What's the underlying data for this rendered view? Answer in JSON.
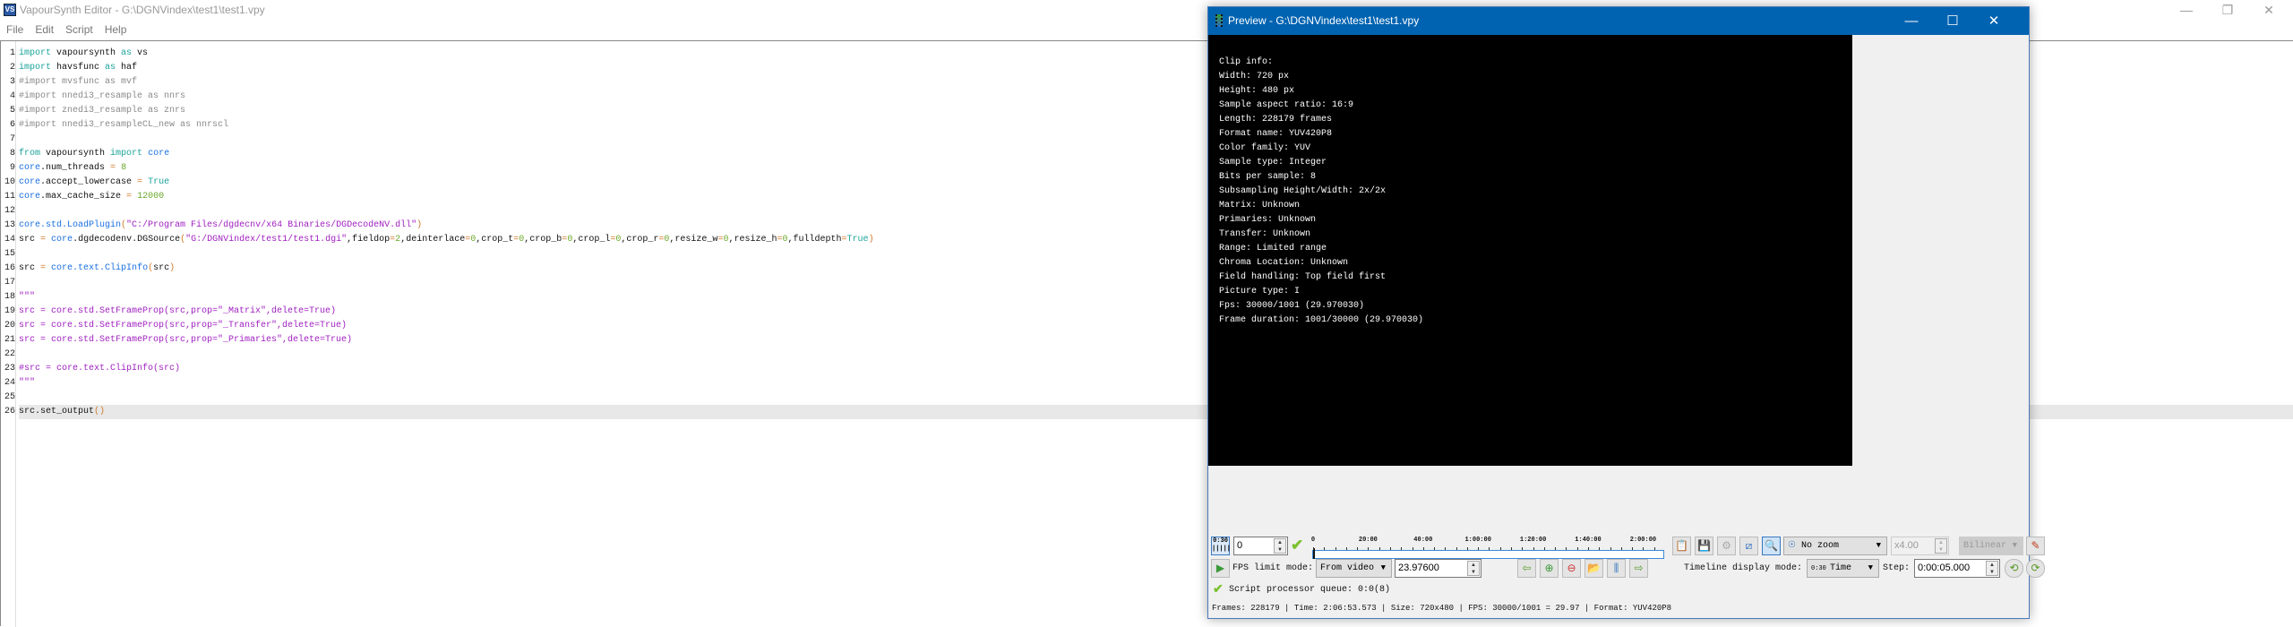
{
  "editor": {
    "title": "VapourSynth Editor - G:\\DGNVindex\\test1\\test1.vpy",
    "logo": "VS",
    "window_controls": [
      "minimize-icon",
      "restore-icon",
      "close-icon"
    ],
    "menu": [
      "File",
      "Edit",
      "Script",
      "Help"
    ],
    "lines": [
      [
        [
          "import",
          "k"
        ],
        [
          " vapoursynth ",
          "p"
        ],
        [
          "as",
          "k"
        ],
        [
          " vs",
          "p"
        ]
      ],
      [
        [
          "import",
          "k"
        ],
        [
          " havsfunc ",
          "p"
        ],
        [
          "as",
          "k"
        ],
        [
          " haf",
          "p"
        ]
      ],
      [
        [
          "#import mvsfunc as mvf",
          "c"
        ]
      ],
      [
        [
          "#import nnedi3_resample as nnrs",
          "c"
        ]
      ],
      [
        [
          "#import znedi3_resample as znrs",
          "c"
        ]
      ],
      [
        [
          "#import nnedi3_resampleCL_new as nnrscl",
          "c"
        ]
      ],
      [],
      [
        [
          "from",
          "k"
        ],
        [
          " vapoursynth ",
          "p"
        ],
        [
          "import",
          "k"
        ],
        [
          " ",
          "p"
        ],
        [
          "core",
          "b"
        ]
      ],
      [
        [
          "core",
          "b"
        ],
        [
          ".num_threads ",
          "p"
        ],
        [
          "=",
          "o"
        ],
        [
          " ",
          "p"
        ],
        [
          "8",
          "n"
        ]
      ],
      [
        [
          "core",
          "b"
        ],
        [
          ".accept_lowercase ",
          "p"
        ],
        [
          "=",
          "o"
        ],
        [
          " ",
          "p"
        ],
        [
          "True",
          "k"
        ]
      ],
      [
        [
          "core",
          "b"
        ],
        [
          ".max_cache_size ",
          "p"
        ],
        [
          "=",
          "o"
        ],
        [
          " ",
          "p"
        ],
        [
          "12000",
          "n"
        ]
      ],
      [],
      [
        [
          "core.std.LoadPlugin",
          "b"
        ],
        [
          "(",
          "o"
        ],
        [
          "\"C:/Program Files/dgdecnv/x64 Binaries/DGDecodeNV.dll\"",
          "s"
        ],
        [
          ")",
          "o"
        ]
      ],
      [
        [
          "src ",
          "p"
        ],
        [
          "=",
          "o"
        ],
        [
          " ",
          "p"
        ],
        [
          "core",
          "b"
        ],
        [
          ".dgdecodenv.DGSource",
          "p"
        ],
        [
          "(",
          "o"
        ],
        [
          "\"G:/DGNVindex/test1/test1.dgi\"",
          "s"
        ],
        [
          ",fieldop",
          "p"
        ],
        [
          "=",
          "o"
        ],
        [
          "2",
          "n"
        ],
        [
          ",deinterlace",
          "p"
        ],
        [
          "=",
          "o"
        ],
        [
          "0",
          "n"
        ],
        [
          ",crop_t",
          "p"
        ],
        [
          "=",
          "o"
        ],
        [
          "0",
          "n"
        ],
        [
          ",crop_b",
          "p"
        ],
        [
          "=",
          "o"
        ],
        [
          "0",
          "n"
        ],
        [
          ",crop_l",
          "p"
        ],
        [
          "=",
          "o"
        ],
        [
          "0",
          "n"
        ],
        [
          ",crop_r",
          "p"
        ],
        [
          "=",
          "o"
        ],
        [
          "0",
          "n"
        ],
        [
          ",resize_w",
          "p"
        ],
        [
          "=",
          "o"
        ],
        [
          "0",
          "n"
        ],
        [
          ",resize_h",
          "p"
        ],
        [
          "=",
          "o"
        ],
        [
          "0",
          "n"
        ],
        [
          ",fulldepth",
          "p"
        ],
        [
          "=",
          "o"
        ],
        [
          "True",
          "k"
        ],
        [
          ")",
          "o"
        ]
      ],
      [],
      [
        [
          "src ",
          "p"
        ],
        [
          "=",
          "o"
        ],
        [
          " ",
          "p"
        ],
        [
          "core.text.ClipInfo",
          "b"
        ],
        [
          "(",
          "o"
        ],
        [
          "src",
          "p"
        ],
        [
          ")",
          "o"
        ]
      ],
      [],
      [
        [
          "\"\"\"",
          "d"
        ]
      ],
      [
        [
          "src = core.std.SetFrameProp(src,prop=\"_Matrix\",delete=True)",
          "d"
        ]
      ],
      [
        [
          "src = core.std.SetFrameProp(src,prop=\"_Transfer\",delete=True)",
          "d"
        ]
      ],
      [
        [
          "src = core.std.SetFrameProp(src,prop=\"_Primaries\",delete=True)",
          "d"
        ]
      ],
      [],
      [
        [
          "#src = core.text.ClipInfo(src)",
          "d"
        ]
      ],
      [
        [
          "\"\"\"",
          "d"
        ]
      ],
      [],
      [
        [
          "src.set_output",
          "p"
        ],
        [
          "()",
          "o"
        ]
      ]
    ],
    "current_line": 26
  },
  "preview": {
    "title": "Preview - G:\\DGNVindex\\test1\\test1.vpy",
    "clip_info": "Clip info:\nWidth: 720 px\nHeight: 480 px\nSample aspect ratio: 16:9\nLength: 228179 frames\nFormat name: YUV420P8\nColor family: YUV\nSample type: Integer\nBits per sample: 8\nSubsampling Height/Width: 2x/2x\nMatrix: Unknown\nPrimaries: Unknown\nTransfer: Unknown\nRange: Limited range\nChroma Location: Unknown\nField handling: Top field first\nPicture type: I\nFps: 30000/1001 (29.970030)\nFrame duration: 1001/30000 (29.970030)",
    "timeline_mode_icon": "0:30",
    "frame_value": "0",
    "timeline": {
      "labels": [
        "0",
        "20:00",
        "40:00",
        "1:00:00",
        "1:20:00",
        "1:40:00",
        "2:00:00"
      ],
      "position": 0
    },
    "zoom_mode": "No zoom",
    "zoom_ratio": "x4.00",
    "scaling": "Bilinear",
    "fps_limit_label": "FPS limit mode:",
    "fps_limit_mode": "From video",
    "fps_value": "23.97600",
    "timeline_display_label": "Timeline display mode:",
    "timeline_display_mode": "Time",
    "step_label": "Step:",
    "step_value": "0:00:05.000",
    "queue_status": "Script processor queue: 0:0(8)",
    "status": "Frames: 228179 | Time: 2:06:53.573 | Size: 720x480 | FPS: 30000/1001 = 29.97 | Format: YUV420P8"
  },
  "colors": {
    "titlebar": "#0063b1",
    "keyword": "#1aa39a",
    "builtin": "#1a6fe0",
    "number": "#6aa82a",
    "string": "#a020c0",
    "comment": "#8a8a8a"
  }
}
